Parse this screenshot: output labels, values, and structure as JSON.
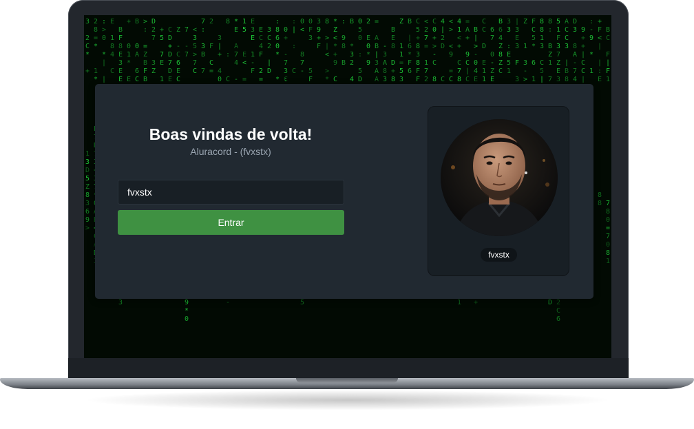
{
  "login": {
    "title": "Boas vindas de volta!",
    "subtitle": "Aluracord - (fvxstx)",
    "username_value": "fvxstx",
    "submit_label": "Entrar"
  },
  "profile": {
    "username": "fvxstx"
  },
  "colors": {
    "card_background": "#212931",
    "input_background": "#181f25",
    "button_green": "#3f9142",
    "matrix_green": "#1fd13a"
  },
  "background_theme": "matrix-code-rain"
}
